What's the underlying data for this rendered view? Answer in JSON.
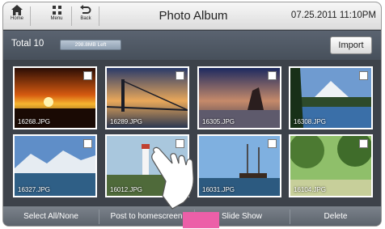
{
  "topbar": {
    "home_label": "Home",
    "menu_label": "Menu",
    "back_label": "Back",
    "title": "Photo Album",
    "datetime": "07.25.2011 11:10PM"
  },
  "infobar": {
    "total": "Total 10",
    "storage": "298.8MB Left",
    "import_label": "Import"
  },
  "photos": [
    {
      "name": "16268.JPG",
      "scene": "sunset"
    },
    {
      "name": "16289.JPG",
      "scene": "bridge"
    },
    {
      "name": "16305.JPG",
      "scene": "beach-rock"
    },
    {
      "name": "16308.JPG",
      "scene": "mountain-lake"
    },
    {
      "name": "16327.JPG",
      "scene": "glacier"
    },
    {
      "name": "16012.JPG",
      "scene": "lighthouse"
    },
    {
      "name": "16031.JPG",
      "scene": "ship"
    },
    {
      "name": "16104.JPG",
      "scene": "tree-alley"
    }
  ],
  "bottombar": {
    "select_all": "Select All/None",
    "post": "Post to homescreen",
    "slideshow": "Slide Show",
    "delete": "Delete"
  }
}
